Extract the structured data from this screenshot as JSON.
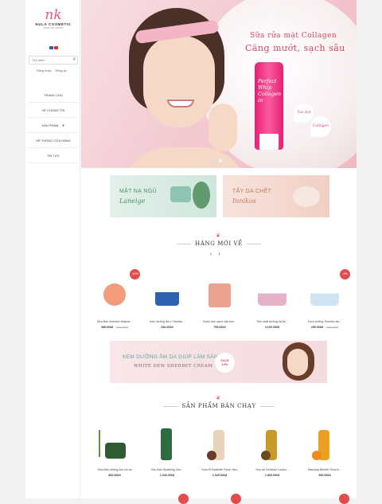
{
  "sidebar": {
    "logo": {
      "mono": "nk",
      "brand": "NULA COSMETIC",
      "tagline": "Make up forever"
    },
    "search": {
      "placeholder": "Tìm kiếm"
    },
    "auth": {
      "login": "Đăng nhập",
      "register": "Đăng ký"
    },
    "nav": [
      {
        "label": "TRANG CHỦ"
      },
      {
        "label": "VỀ CHÚNG TÔI"
      },
      {
        "label": "SẢN PHẨM"
      },
      {
        "label": "HỆ THỐNG CỬA HÀNG"
      },
      {
        "label": "TIN TỨC"
      }
    ]
  },
  "hero": {
    "line1": "Sữa rửa mặt Collagen",
    "line2": "Căng mướt, sạch sâu",
    "tube_text": "Perfect Whip Collagen in",
    "drop1": "Tạo bọt",
    "drop2": "Collagen"
  },
  "promos": [
    {
      "line1": "MẶT NẠ NGỦ",
      "line2": "Laneige"
    },
    {
      "line1": "TẨY DA CHẾT",
      "line2": "Innikos"
    }
  ],
  "section_new": {
    "title": "HÀNG MỚI VỀ",
    "prev": "‹",
    "next": "›"
  },
  "new_products": [
    {
      "name": "Sữa Bán Xinhskin Mascar...",
      "price": "388.000đ",
      "old_price": "420.000đ",
      "badge": "-10%",
      "color": "#f39b7a"
    },
    {
      "name": "Kem dưỡng ẩm L'Occitan...",
      "price": "640.000đ",
      "old_price": "",
      "badge": "",
      "color": "#2d62b3"
    },
    {
      "name": "Nước làm sạch mặt bụn...",
      "price": "799.000đ",
      "old_price": "",
      "badge": "",
      "color": "#e9a38e"
    },
    {
      "name": "Tinh chất dưỡng da Mi...",
      "price": "4.100.000đ",
      "old_price": "",
      "badge": "",
      "color": "#e6b2c8"
    },
    {
      "name": "Kem dưỡng Tinuniko da...",
      "price": "290.000đ",
      "old_price": "326.000đ",
      "badge": "-9%",
      "color": "#cfe4f3"
    }
  ],
  "midbanner": {
    "line1": "KEM DƯỠNG ẨM DA GIÚP LÀM SÁNG DA",
    "line2": "WHITE DEW SHERBET CREAM",
    "sale": "SALE",
    "sale_pct": "10%"
  },
  "section_best": {
    "title": "SẢN PHẨM BÁN CHẠY"
  },
  "best_products": [
    {
      "name": "Sữa Bán dưỡng Ẩm vùi da",
      "price": "800.000đ",
      "color": "#2f5b33"
    },
    {
      "name": "Gốu Bán Sparkling Cèu...",
      "price": "1.040.000đ",
      "color": "#2e6b40"
    },
    {
      "name": "Kem Ri Barbette Fresh Vero",
      "price": "1.025.000đ",
      "color": "#e8d4b8"
    },
    {
      "name": "Sơn tái Christian Louieu...",
      "price": "1.800.000đ",
      "color": "#c89a2a"
    },
    {
      "name": "Mascara Benefit They're...",
      "price": "950.000đ",
      "color": "#e9a020"
    }
  ]
}
